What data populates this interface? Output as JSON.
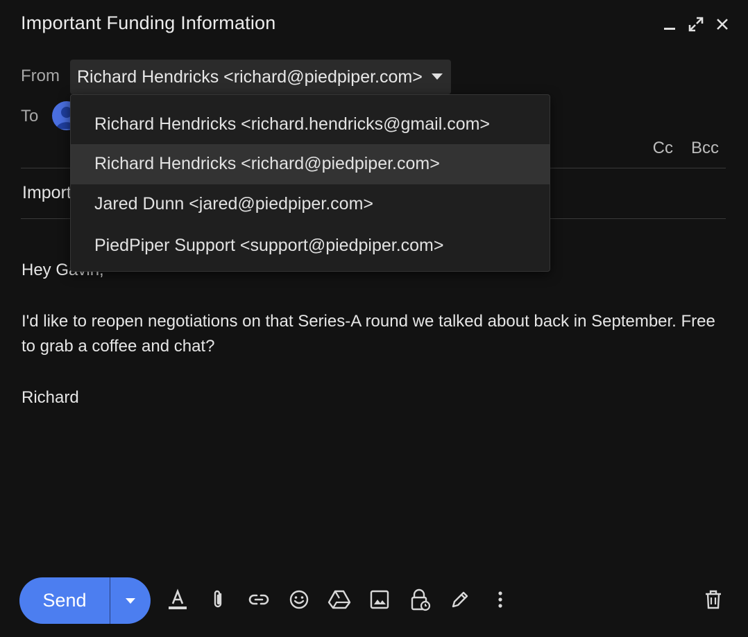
{
  "window": {
    "title": "Important Funding Information"
  },
  "from": {
    "label": "From",
    "selected": "Richard Hendricks <richard@piedpiper.com>"
  },
  "to": {
    "label": "To",
    "cc": "Cc",
    "bcc": "Bcc"
  },
  "subject": {
    "value": "Important Funding Information"
  },
  "dropdown": {
    "options": [
      "Richard Hendricks <richard.hendricks@gmail.com>",
      "Richard Hendricks <richard@piedpiper.com>",
      "Jared Dunn <jared@piedpiper.com>",
      "PiedPiper Support <support@piedpiper.com>"
    ],
    "highlighted_index": 1
  },
  "body": {
    "greeting": "Hey Gavin,",
    "paragraph": "I'd like to reopen negotiations on that Series-A round we talked about back in September. Free to grab a coffee and chat?",
    "signature": "Richard"
  },
  "toolbar": {
    "send_label": "Send",
    "icons": [
      "format-text-icon",
      "attach-icon",
      "link-icon",
      "emoji-icon",
      "drive-icon",
      "photo-icon",
      "confidential-lock-icon",
      "signature-pen-icon",
      "more-options-icon",
      "trash-icon"
    ]
  },
  "colors": {
    "accent": "#4c7ef0",
    "background": "#121212",
    "menu_bg": "#1f1f1f",
    "menu_highlight": "#333333"
  }
}
